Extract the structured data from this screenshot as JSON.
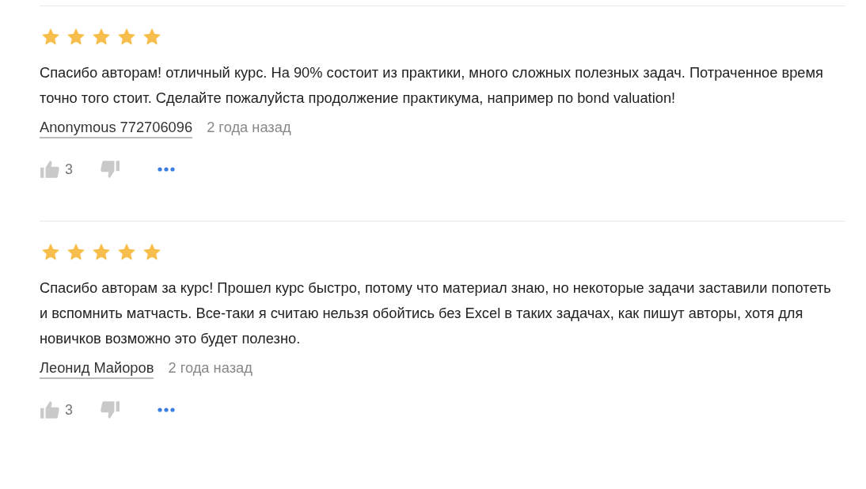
{
  "reviews": [
    {
      "stars": 5,
      "text": "Спасибо авторам! отличный курс. На 90% состоит из практики, много сложных полезных задач. Потраченное время точно того стоит. Сделайте пожалуйста продолжение практикума, например по bond valuation!",
      "author": "Anonymous 772706096",
      "time": "2 года назад",
      "likes": "3"
    },
    {
      "stars": 5,
      "text": "Спасибо авторам за курс! Прошел курс быстро, потому что материал знаю, но некоторые задачи заставили попотеть и вспомнить матчасть. Все-таки я считаю нельзя обойтись без Excel в таких задачах, как пишут авторы, хотя для новичков возможно это будет полезно.",
      "author": "Леонид Майоров",
      "time": "2 года назад",
      "likes": "3"
    }
  ]
}
